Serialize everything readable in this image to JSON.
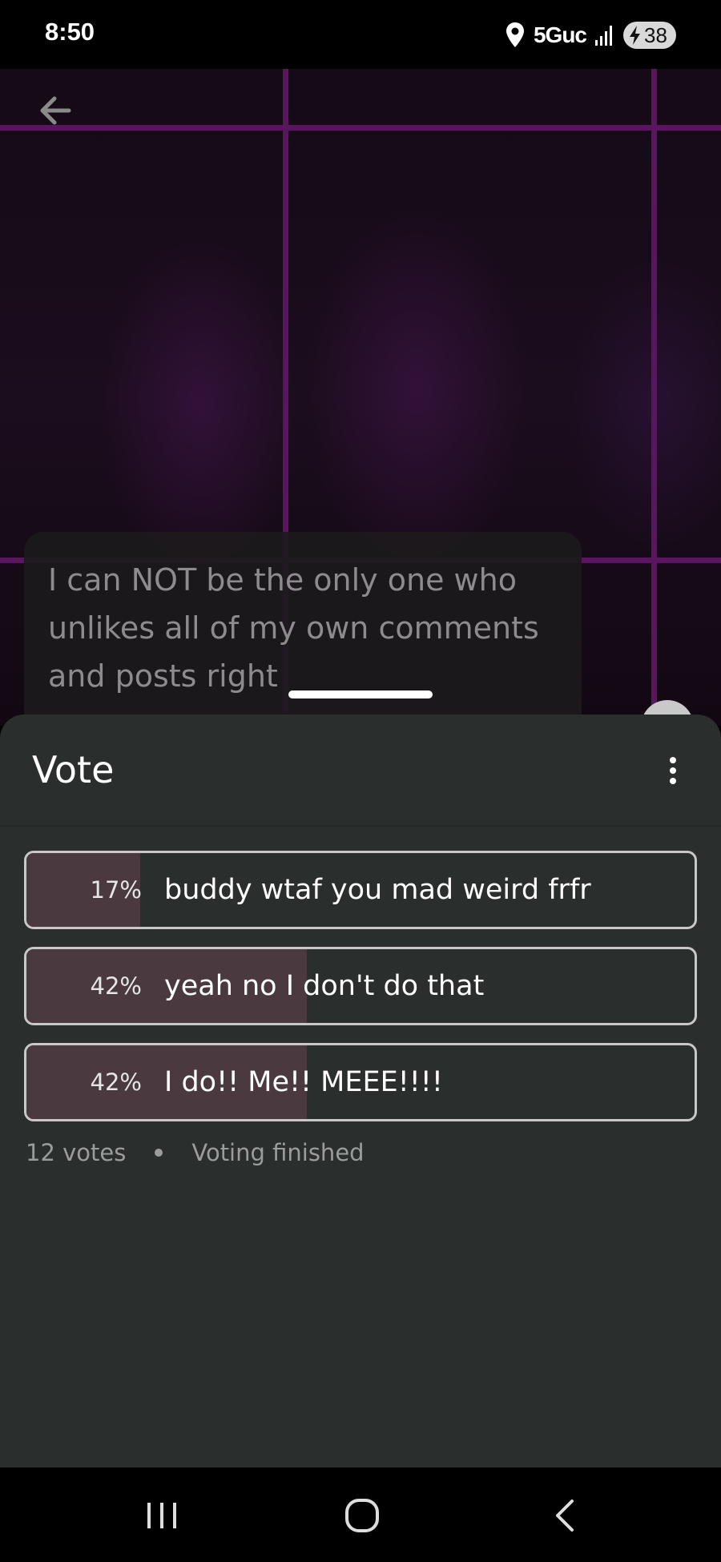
{
  "status_bar": {
    "time": "8:50",
    "network": "5Guc",
    "battery": "38",
    "icons": [
      "location-icon",
      "signal-icon",
      "battery-icon"
    ]
  },
  "post": {
    "text": "I can NOT be the only one who unlikes all of my own comments and posts right"
  },
  "sheet": {
    "title": "Vote",
    "options": [
      {
        "percent_label": "17%",
        "fraction": 0.17,
        "label": "buddy wtaf you mad weird frfr"
      },
      {
        "percent_label": "42%",
        "fraction": 0.42,
        "label": "yeah no I don't do that"
      },
      {
        "percent_label": "42%",
        "fraction": 0.42,
        "label": "I do!! Me!! MEEE!!!!"
      }
    ],
    "votes": "12 votes",
    "status": "Voting finished"
  },
  "colors": {
    "sheet_bg": "#2a2e2c",
    "option_fill": "#4a3a40",
    "grid_line": "#5a1560"
  },
  "nav_bar": {
    "icons": [
      "recents-icon",
      "home-icon",
      "back-icon"
    ]
  }
}
